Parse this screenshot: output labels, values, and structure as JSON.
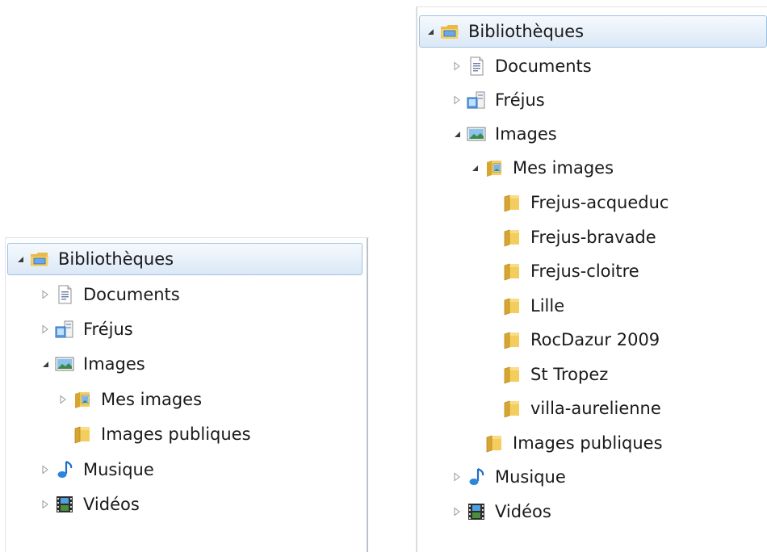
{
  "left_pane": {
    "items": [
      {
        "label": "Bibliothèques",
        "icon": "library-icon",
        "expander": "expanded",
        "selected": true
      },
      {
        "label": "Documents",
        "icon": "documents-icon",
        "expander": "collapsed"
      },
      {
        "label": "Fréjus",
        "icon": "computer-icon",
        "expander": "collapsed"
      },
      {
        "label": "Images",
        "icon": "images-icon",
        "expander": "expanded"
      },
      {
        "label": "Mes images",
        "icon": "folder-images-icon",
        "expander": "collapsed"
      },
      {
        "label": "Images publiques",
        "icon": "folder-icon",
        "expander": "none"
      },
      {
        "label": "Musique",
        "icon": "music-icon",
        "expander": "collapsed"
      },
      {
        "label": "Vidéos",
        "icon": "videos-icon",
        "expander": "collapsed"
      }
    ]
  },
  "right_pane": {
    "items": [
      {
        "label": "Bibliothèques",
        "icon": "library-icon",
        "expander": "expanded",
        "selected": true
      },
      {
        "label": "Documents",
        "icon": "documents-icon",
        "expander": "collapsed"
      },
      {
        "label": "Fréjus",
        "icon": "computer-icon",
        "expander": "collapsed"
      },
      {
        "label": "Images",
        "icon": "images-icon",
        "expander": "expanded"
      },
      {
        "label": "Mes images",
        "icon": "folder-images-icon",
        "expander": "expanded"
      },
      {
        "label": "Frejus-acqueduc",
        "icon": "folder-icon",
        "expander": "none"
      },
      {
        "label": "Frejus-bravade",
        "icon": "folder-icon",
        "expander": "none"
      },
      {
        "label": "Frejus-cloitre",
        "icon": "folder-icon",
        "expander": "none"
      },
      {
        "label": "Lille",
        "icon": "folder-icon",
        "expander": "none"
      },
      {
        "label": "RocDazur 2009",
        "icon": "folder-icon",
        "expander": "none"
      },
      {
        "label": "St Tropez",
        "icon": "folder-icon",
        "expander": "none"
      },
      {
        "label": "villa-aurelienne",
        "icon": "folder-icon",
        "expander": "none"
      },
      {
        "label": "Images publiques",
        "icon": "folder-icon",
        "expander": "none"
      },
      {
        "label": "Musique",
        "icon": "music-icon",
        "expander": "collapsed"
      },
      {
        "label": "Vidéos",
        "icon": "videos-icon",
        "expander": "collapsed"
      }
    ]
  }
}
